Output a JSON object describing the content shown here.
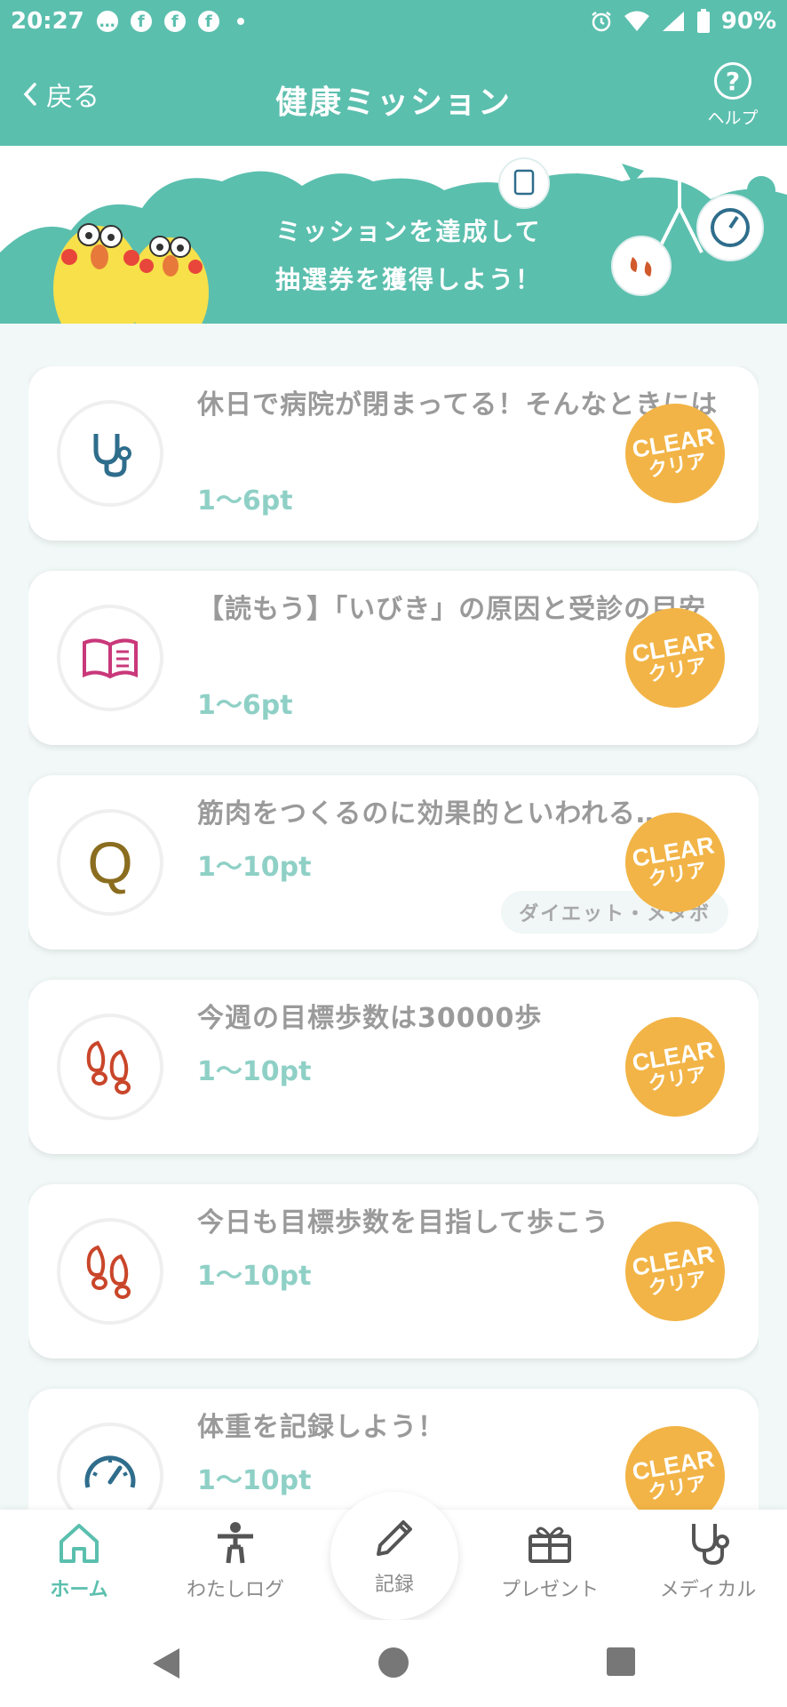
{
  "status_bar": {
    "time": "20:27",
    "battery": "90%",
    "left_icons": [
      "chat-icon",
      "facebook-icon",
      "facebook-icon",
      "facebook-icon"
    ],
    "right_icons": [
      "alarm-icon",
      "wifi-icon",
      "signal-icon",
      "battery-icon"
    ]
  },
  "header": {
    "back_label": "戻る",
    "title": "健康ミッション",
    "help_label": "ヘルプ",
    "help_symbol": "?"
  },
  "banner": {
    "line1": "ミッションを達成して",
    "line2": "抽選券を獲得しよう！"
  },
  "badge": {
    "en": "CLEAR",
    "jp": "クリア"
  },
  "missions": [
    {
      "title": "休日で病院が閉まってる！そんなときには",
      "points": "1〜6pt",
      "icon": "stethoscope-icon",
      "status": "clear",
      "tag": ""
    },
    {
      "title": "【読もう】「いびき」の原因と受診の目安",
      "points": "1〜6pt",
      "icon": "book-icon",
      "status": "clear",
      "tag": ""
    },
    {
      "title": "筋肉をつくるのに効果的といわれる…",
      "points": "1〜10pt",
      "icon": "quiz-icon",
      "status": "clear",
      "tag": "ダイエット・メタボ"
    },
    {
      "title": "今週の目標歩数は30000歩",
      "points": "1〜10pt",
      "icon": "footsteps-icon",
      "status": "clear",
      "tag": ""
    },
    {
      "title": "今日も目標歩数を目指して歩こう",
      "points": "1〜10pt",
      "icon": "footsteps-icon",
      "status": "clear",
      "tag": ""
    },
    {
      "title": "体重を記録しよう！",
      "points": "1〜10pt",
      "icon": "scale-icon",
      "status": "clear",
      "tag": ""
    }
  ],
  "quiz_letter": "Q",
  "bottom_nav": {
    "home": "ホーム",
    "log": "わたしログ",
    "record": "記録",
    "present": "プレゼント",
    "medical": "メディカル",
    "active": "home"
  },
  "colors": {
    "primary": "#5bbfae",
    "points": "#8fd0c6",
    "badge": "#f2b446",
    "text": "#9a9a9a"
  }
}
